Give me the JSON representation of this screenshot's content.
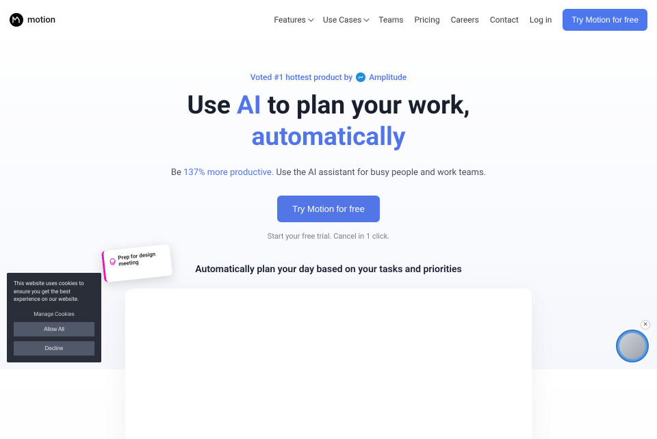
{
  "brand": "motion",
  "nav": {
    "items": [
      {
        "label": "Features",
        "dropdown": true
      },
      {
        "label": "Use Cases",
        "dropdown": true
      },
      {
        "label": "Teams",
        "dropdown": false
      },
      {
        "label": "Pricing",
        "dropdown": false
      },
      {
        "label": "Careers",
        "dropdown": false
      },
      {
        "label": "Contact",
        "dropdown": false
      },
      {
        "label": "Log in",
        "dropdown": false
      }
    ],
    "cta": "Try Motion for free"
  },
  "hero": {
    "voted_prefix": "Voted #1 hottest product by",
    "voted_brand": "Amplitude",
    "headline_1a": "Use ",
    "headline_1b": "AI",
    "headline_1c": " to plan your work,",
    "headline_2": "automatically",
    "sub_prefix": "Be ",
    "sub_link": "137% more productive.",
    "sub_suffix": " Use the AI assistant for busy people and work teams.",
    "cta": "Try Motion for free",
    "trial_note": "Start your free trial. Cancel in 1 click."
  },
  "section_title": "Automatically plan your day based on your tasks and priorities",
  "floating_card": "Prep for design meeting",
  "cookies": {
    "text": "This website uses cookies to ensure you get the best experience on our website.",
    "manage": "Manage Cookies",
    "allow": "Allow All",
    "decline": "Decline"
  }
}
